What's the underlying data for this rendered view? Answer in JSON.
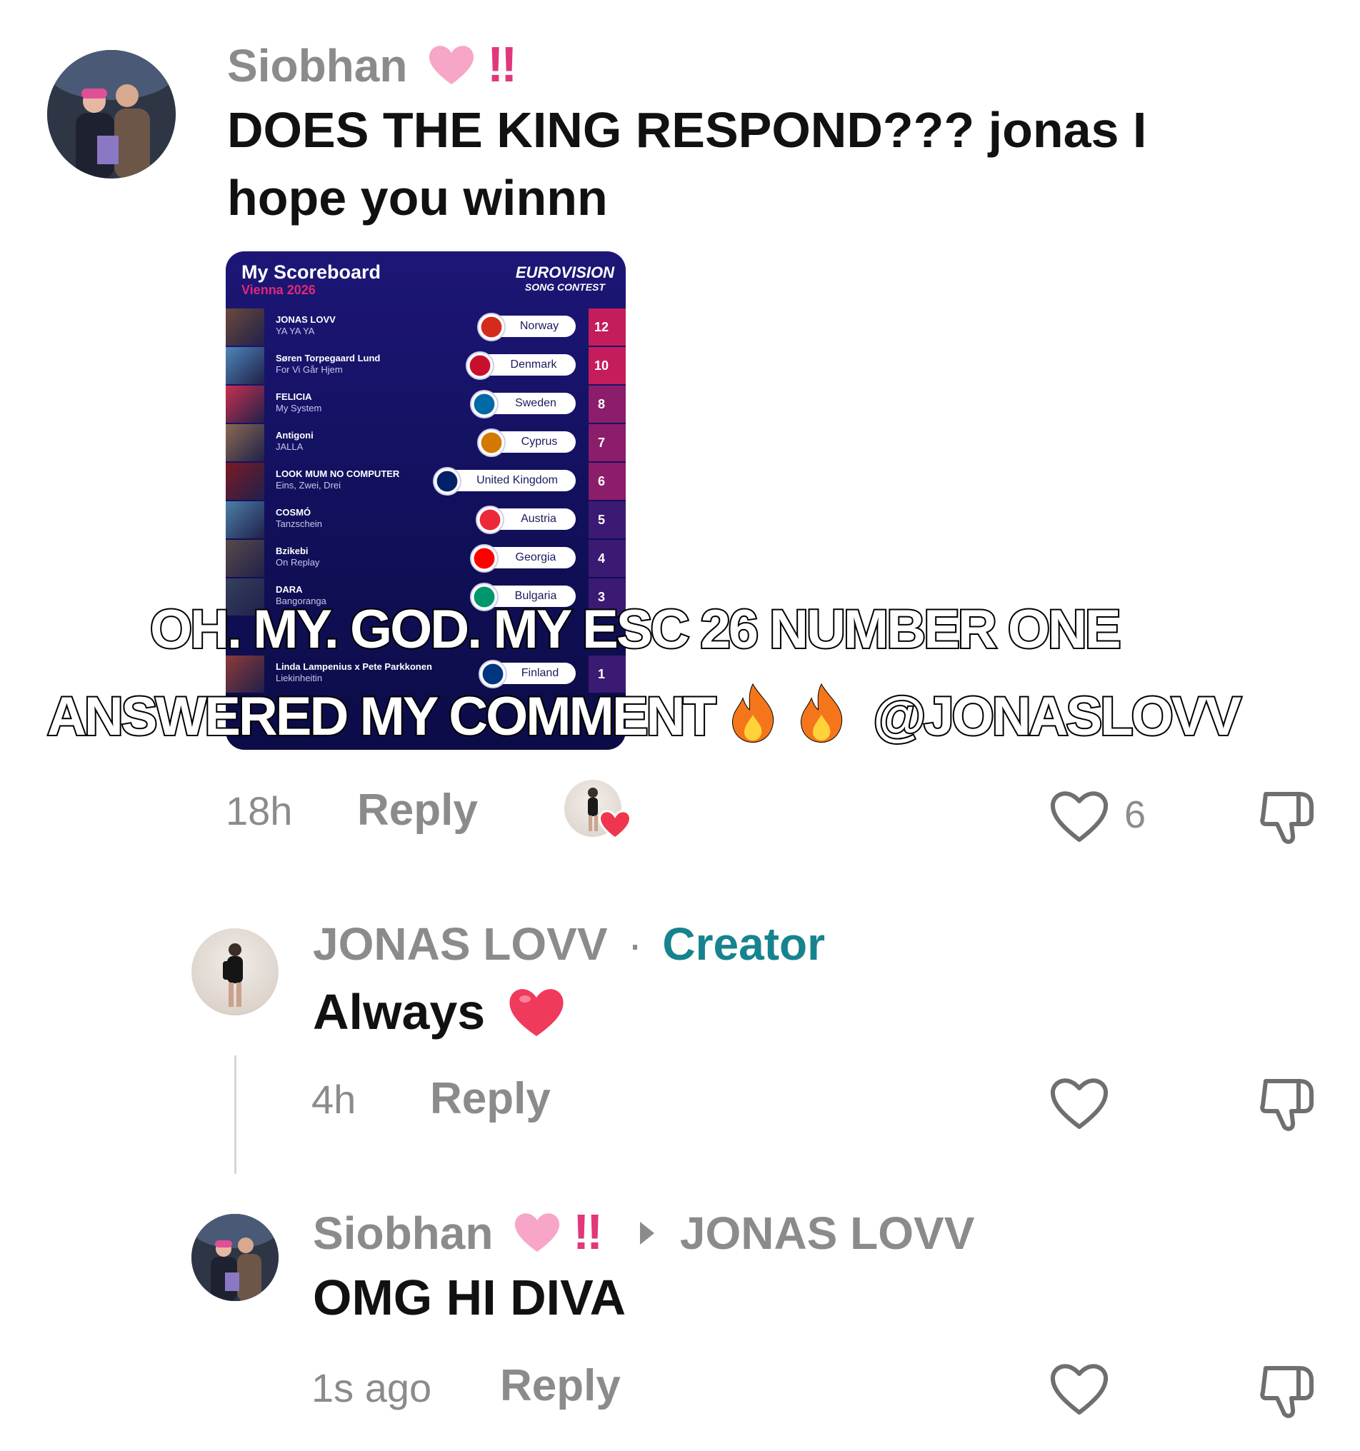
{
  "comments": [
    {
      "username": "Siobhan",
      "username_suffix": "‼",
      "text": "DOES THE KING RESPOND??? jonas I hope you winnn",
      "time": "18h",
      "reply_label": "Reply",
      "likes": "6",
      "liked_by_creator": true
    },
    {
      "username": "JONAS LOVV",
      "separator": "·",
      "creator_label": "Creator",
      "text": "Always",
      "time": "4h",
      "reply_label": "Reply"
    },
    {
      "username": "Siobhan",
      "username_suffix": "‼",
      "reply_to": "JONAS LOVV",
      "text": "OMG HI DIVA",
      "time": "1s ago",
      "reply_label": "Reply"
    }
  ],
  "scoreboard": {
    "title": "My Scoreboard",
    "subtitle": "Vienna 2026",
    "logo_line1": "EUROVISION",
    "logo_line2": "SONG CONTEST",
    "rows": [
      {
        "artist": "JONAS LOVV",
        "song": "YA YA YA",
        "country": "Norway",
        "points": "12"
      },
      {
        "artist": "Søren Torpegaard Lund",
        "song": "For Vi Går Hjem",
        "country": "Denmark",
        "points": "10"
      },
      {
        "artist": "FELICIA",
        "song": "My System",
        "country": "Sweden",
        "points": "8"
      },
      {
        "artist": "Antigoni",
        "song": "JALLA",
        "country": "Cyprus",
        "points": "7"
      },
      {
        "artist": "LOOK MUM NO COMPUTER",
        "song": "Eins, Zwei, Drei",
        "country": "United Kingdom",
        "points": "6"
      },
      {
        "artist": "COSMÓ",
        "song": "Tanzschein",
        "country": "Austria",
        "points": "5"
      },
      {
        "artist": "Bzikebi",
        "song": "On Replay",
        "country": "Georgia",
        "points": "4"
      },
      {
        "artist": "DARA",
        "song": "Bangoranga",
        "country": "Bulgaria",
        "points": "3"
      },
      {
        "artist": "Linda Lampenius x Pete Parkkonen",
        "song": "Liekinheitin",
        "country": "Finland",
        "points": "1"
      }
    ]
  },
  "overlay": {
    "line1": "OH. MY. GOD. MY ESC 26 NUMBER ONE",
    "line2": "ANSWERED MY COMMENT",
    "handle": "@JONASLOVV"
  },
  "icons": {
    "heart_emoji_color": "#f7a6c7",
    "red_heart_color": "#f0364f",
    "exclaim_color": "#e0387a",
    "fire_color": "#f5761a"
  }
}
